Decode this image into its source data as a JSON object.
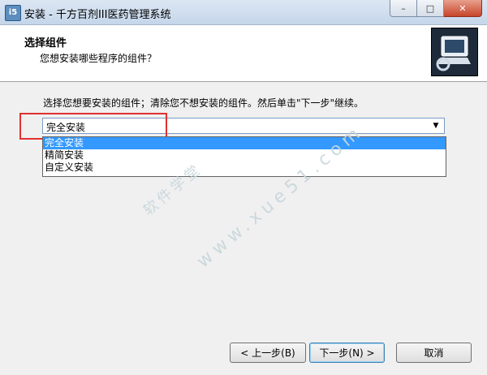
{
  "window": {
    "title": "安装 - 千方百剂III医药管理系统",
    "icon": "installer-icon"
  },
  "header": {
    "title": "选择组件",
    "subtitle": "您想安装哪些程序的组件？"
  },
  "main": {
    "instruction": "选择您想要安装的组件；清除您不想安装的组件。然后单击\"下一步\"继续。",
    "select": {
      "value": "完全安装",
      "options": [
        "完全安装",
        "精简安装",
        "自定义安装"
      ],
      "selected_index": 0
    },
    "watermark": {
      "cn": "软件学堂",
      "latin": "www.xue51.com"
    }
  },
  "footer": {
    "back_label": "< 上一步(B)",
    "next_label": "下一步(N) >",
    "cancel_label": "取消"
  },
  "colors": {
    "highlight": "#e03030",
    "selection": "#3399ff"
  }
}
